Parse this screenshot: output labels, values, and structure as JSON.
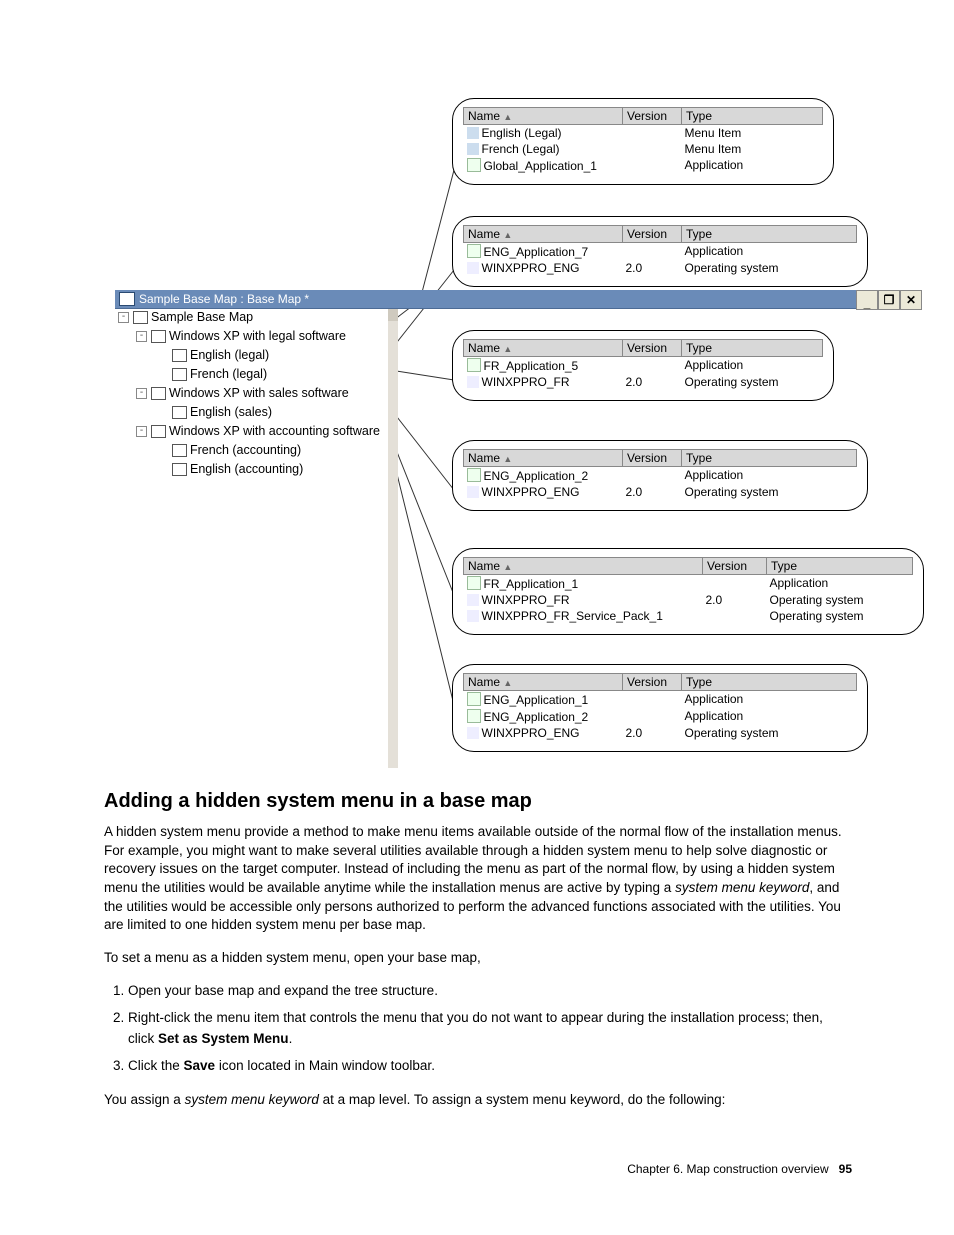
{
  "window": {
    "title": "Sample Base Map : Base Map *"
  },
  "winButtons": {
    "min": "_",
    "max": "□",
    "close": "×"
  },
  "tree": {
    "root": "Sample Base Map",
    "n1": "Windows XP with legal software",
    "n1a": "English (legal)",
    "n1b": "French (legal)",
    "n2": "Windows XP with sales software",
    "n2a": "English (sales)",
    "n3": "Windows XP with accounting software",
    "n3a": "French (accounting)",
    "n3b": "English (accounting)"
  },
  "headers": {
    "name": "Name",
    "version": "Version",
    "type": "Type"
  },
  "bubbles": [
    {
      "rows": [
        {
          "name": "English (Legal)",
          "version": "",
          "type": "Menu Item"
        },
        {
          "name": "French (Legal)",
          "version": "",
          "type": "Menu Item"
        },
        {
          "name": "Global_Application_1",
          "version": "",
          "type": "Application"
        }
      ]
    },
    {
      "rows": [
        {
          "name": "ENG_Application_7",
          "version": "",
          "type": "Application"
        },
        {
          "name": "WINXPPRO_ENG",
          "version": "2.0",
          "type": "Operating system"
        }
      ]
    },
    {
      "rows": [
        {
          "name": "FR_Application_5",
          "version": "",
          "type": "Application"
        },
        {
          "name": "WINXPPRO_FR",
          "version": "2.0",
          "type": "Operating system"
        }
      ]
    },
    {
      "rows": [
        {
          "name": "ENG_Application_2",
          "version": "",
          "type": "Application"
        },
        {
          "name": "WINXPPRO_ENG",
          "version": "2.0",
          "type": "Operating system"
        }
      ]
    },
    {
      "rows": [
        {
          "name": "FR_Application_1",
          "version": "",
          "type": "Application"
        },
        {
          "name": "WINXPPRO_FR",
          "version": "2.0",
          "type": "Operating system"
        },
        {
          "name": "WINXPPRO_FR_Service_Pack_1",
          "version": "",
          "type": "Operating system"
        }
      ]
    },
    {
      "rows": [
        {
          "name": "ENG_Application_1",
          "version": "",
          "type": "Application"
        },
        {
          "name": "ENG_Application_2",
          "version": "",
          "type": "Application"
        },
        {
          "name": "WINXPPRO_ENG",
          "version": "2.0",
          "type": "Operating system"
        }
      ]
    }
  ],
  "section": {
    "heading": "Adding a hidden system menu in a base map",
    "p1a": "A hidden system menu provide a method to make menu items available outside of the normal flow of the installation menus. For example, you might want to make several utilities available through a hidden system menu to help solve diagnostic or recovery issues on the target computer. Instead of including the menu as part of the normal flow, by using a hidden system menu the utilities would be available anytime while the installation menus are active by typing a ",
    "p1i": "system menu keyword",
    "p1b": ", and the utilities would be accessible only persons authorized to perform the advanced functions associated with the utilities. You are limited to one hidden system menu per base map.",
    "p2": "To set a menu as a hidden system menu, open your base map,",
    "li1": "Open your base map and expand the tree structure.",
    "li2a": "Right-click the menu item that controls the menu that you do not want to appear during the installation process; then, click ",
    "li2b": "Set as System Menu",
    "li2c": ".",
    "li3a": "Click the ",
    "li3b": "Save",
    "li3c": " icon located in Main window toolbar.",
    "p3a": "You assign a ",
    "p3i": "system menu keyword",
    "p3b": " at a map level. To assign a system menu keyword, do the following:"
  },
  "footer": {
    "chapter": "Chapter 6.  Map construction overview",
    "page": "95"
  }
}
